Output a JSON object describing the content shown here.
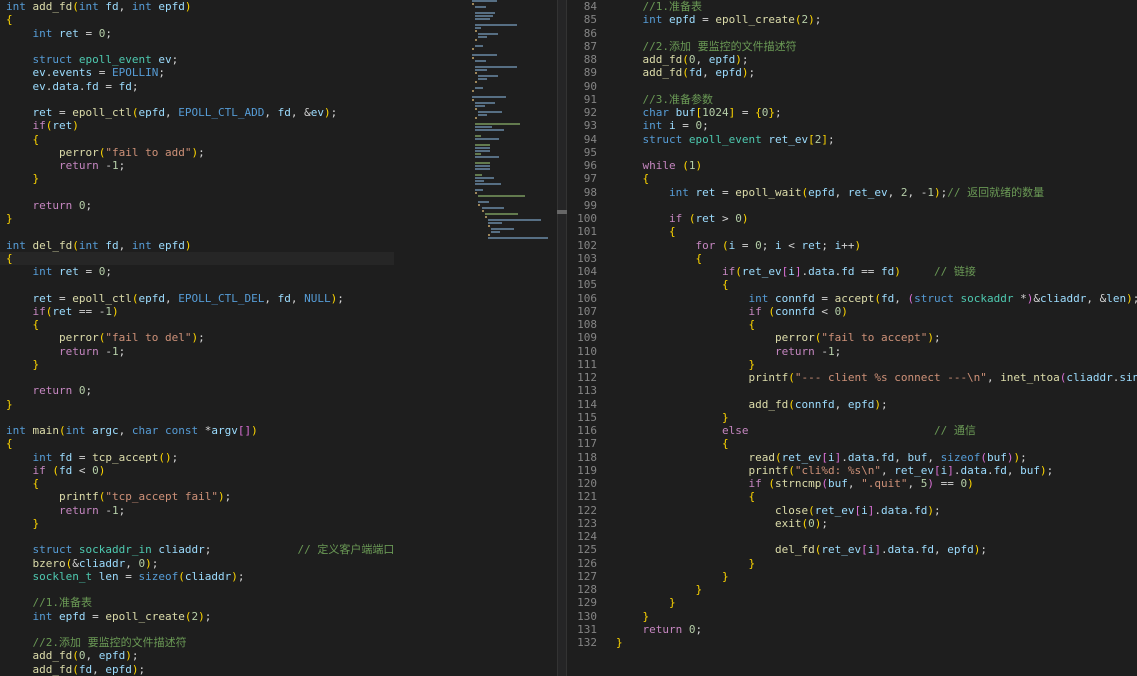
{
  "editor": {
    "left_pane": {
      "lines": [
        "int add_fd(int fd, int epfd)",
        "{",
        "    int ret = 0;",
        "",
        "    struct epoll_event ev;",
        "    ev.events = EPOLLIN;",
        "    ev.data.fd = fd;",
        "",
        "    ret = epoll_ctl(epfd, EPOLL_CTL_ADD, fd, &ev);",
        "    if(ret)",
        "    {",
        "        perror(\"fail to add\");",
        "        return -1;",
        "    }",
        "",
        "    return 0;",
        "}",
        "",
        "int del_fd(int fd, int epfd)",
        "{",
        "    int ret = 0;",
        "",
        "    ret = epoll_ctl(epfd, EPOLL_CTL_DEL, fd, NULL);",
        "    if(ret == -1)",
        "    {",
        "        perror(\"fail to del\");",
        "        return -1;",
        "    }",
        "",
        "    return 0;",
        "}",
        "",
        "int main(int argc, char const *argv[])",
        "{",
        "    int fd = tcp_accept();",
        "    if (fd < 0)",
        "    {",
        "        printf(\"tcp_accept fail\");",
        "        return -1;",
        "    }",
        "",
        "    struct sockaddr_in cliaddr;             // 定义客户端端口",
        "    bzero(&cliaddr, 0);",
        "    socklen_t len = sizeof(cliaddr);",
        "",
        "    //1.准备表",
        "    int epfd = epoll_create(2);",
        "",
        "    //2.添加 要监控的文件描述符",
        "    add_fd(0, epfd);",
        "    add_fd(fd, epfd);"
      ]
    },
    "right_pane": {
      "lines": [
        {
          "n": "84",
          "t": "    //1.准备表"
        },
        {
          "n": "85",
          "t": "    int epfd = epoll_create(2);"
        },
        {
          "n": "86",
          "t": ""
        },
        {
          "n": "87",
          "t": "    //2.添加 要监控的文件描述符"
        },
        {
          "n": "88",
          "t": "    add_fd(0, epfd);"
        },
        {
          "n": "89",
          "t": "    add_fd(fd, epfd);"
        },
        {
          "n": "90",
          "t": ""
        },
        {
          "n": "91",
          "t": "    //3.准备参数"
        },
        {
          "n": "92",
          "t": "    char buf[1024] = {0};"
        },
        {
          "n": "93",
          "t": "    int i = 0;"
        },
        {
          "n": "94",
          "t": "    struct epoll_event ret_ev[2];"
        },
        {
          "n": "95",
          "t": ""
        },
        {
          "n": "96",
          "t": "    while (1)"
        },
        {
          "n": "97",
          "t": "    {"
        },
        {
          "n": "98",
          "t": "        int ret = epoll_wait(epfd, ret_ev, 2, -1);// 返回就绪的数量"
        },
        {
          "n": "99",
          "t": ""
        },
        {
          "n": "100",
          "t": "        if (ret > 0)"
        },
        {
          "n": "101",
          "t": "        {"
        },
        {
          "n": "102",
          "t": "            for (i = 0; i < ret; i++)"
        },
        {
          "n": "103",
          "t": "            {"
        },
        {
          "n": "104",
          "t": "                if(ret_ev[i].data.fd == fd)     // 链接"
        },
        {
          "n": "105",
          "t": "                {"
        },
        {
          "n": "106",
          "t": "                    int connfd = accept(fd, (struct sockaddr *)&cliaddr, &len);"
        },
        {
          "n": "107",
          "t": "                    if (connfd < 0)"
        },
        {
          "n": "108",
          "t": "                    {"
        },
        {
          "n": "109",
          "t": "                        perror(\"fail to accept\");"
        },
        {
          "n": "110",
          "t": "                        return -1;"
        },
        {
          "n": "111",
          "t": "                    }"
        },
        {
          "n": "112",
          "t": "                    printf(\"--- client %s connect ---\\n\", inet_ntoa(cliaddr.sin_addr));"
        },
        {
          "n": "113",
          "t": ""
        },
        {
          "n": "114",
          "t": "                    add_fd(connfd, epfd);"
        },
        {
          "n": "115",
          "t": "                }"
        },
        {
          "n": "116",
          "t": "                else                            // 通信"
        },
        {
          "n": "117",
          "t": "                {"
        },
        {
          "n": "118",
          "t": "                    read(ret_ev[i].data.fd, buf, sizeof(buf));"
        },
        {
          "n": "119",
          "t": "                    printf(\"cli%d: %s\\n\", ret_ev[i].data.fd, buf);"
        },
        {
          "n": "120",
          "t": "                    if (strncmp(buf, \".quit\", 5) == 0)"
        },
        {
          "n": "121",
          "t": "                    {"
        },
        {
          "n": "122",
          "t": "                        close(ret_ev[i].data.fd);"
        },
        {
          "n": "123",
          "t": "                        exit(0);"
        },
        {
          "n": "124",
          "t": ""
        },
        {
          "n": "125",
          "t": "                        del_fd(ret_ev[i].data.fd, epfd);"
        },
        {
          "n": "126",
          "t": "                    }"
        },
        {
          "n": "127",
          "t": "                }"
        },
        {
          "n": "128",
          "t": "            }"
        },
        {
          "n": "129",
          "t": "        }"
        },
        {
          "n": "130",
          "t": "    }"
        },
        {
          "n": "131",
          "t": "    return 0;"
        },
        {
          "n": "132",
          "t": "}"
        }
      ]
    }
  },
  "colors": {
    "background": "#1e1e1e",
    "keyword": "#569cd6",
    "control": "#c586c0",
    "type": "#4ec9b0",
    "function": "#dcdcaa",
    "variable": "#9cdcfe",
    "string": "#ce9178",
    "number": "#b5cea8",
    "comment": "#6a9955",
    "line_number": "#858585"
  }
}
